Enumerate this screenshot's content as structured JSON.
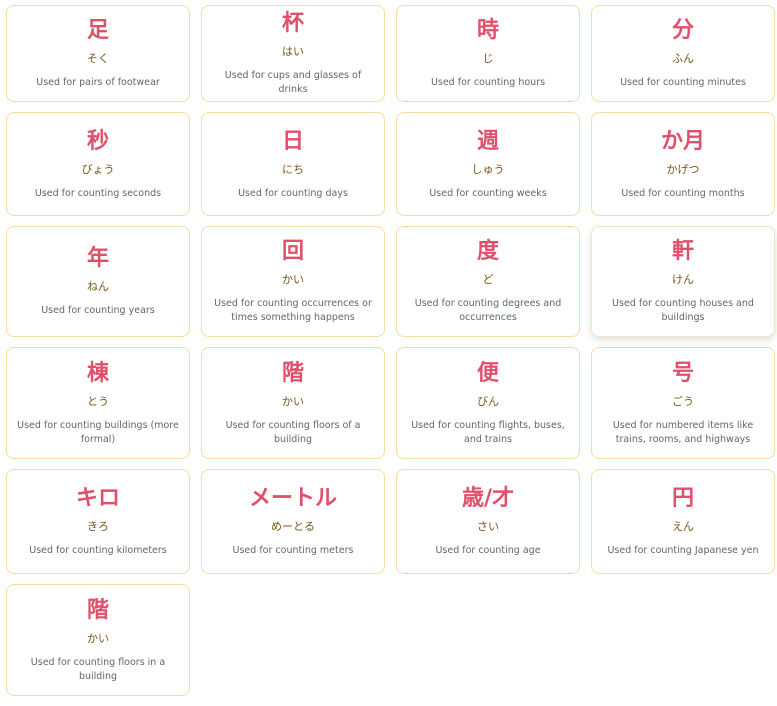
{
  "colors": {
    "kanji": "#e0506a",
    "reading": "#7a5518",
    "description": "#5f6671",
    "card_border": "#f4dca4"
  },
  "counters": [
    {
      "kanji": "足",
      "reading": "そく",
      "description": "Used for pairs of footwear"
    },
    {
      "kanji": "杯",
      "reading": "はい",
      "description": "Used for cups and glasses of drinks"
    },
    {
      "kanji": "時",
      "reading": "じ",
      "description": "Used for counting hours"
    },
    {
      "kanji": "分",
      "reading": "ふん",
      "description": "Used for counting minutes"
    },
    {
      "kanji": "秒",
      "reading": "びょう",
      "description": "Used for counting seconds"
    },
    {
      "kanji": "日",
      "reading": "にち",
      "description": "Used for counting days"
    },
    {
      "kanji": "週",
      "reading": "しゅう",
      "description": "Used for counting weeks"
    },
    {
      "kanji": "か月",
      "reading": "かげつ",
      "description": "Used for counting months"
    },
    {
      "kanji": "年",
      "reading": "ねん",
      "description": "Used for counting years"
    },
    {
      "kanji": "回",
      "reading": "かい",
      "description": "Used for counting occurrences or times something happens"
    },
    {
      "kanji": "度",
      "reading": "ど",
      "description": "Used for counting degrees and occurrences"
    },
    {
      "kanji": "軒",
      "reading": "けん",
      "description": "Used for counting houses and buildings"
    },
    {
      "kanji": "棟",
      "reading": "とう",
      "description": "Used for counting buildings (more formal)"
    },
    {
      "kanji": "階",
      "reading": "かい",
      "description": "Used for counting floors of a building"
    },
    {
      "kanji": "便",
      "reading": "びん",
      "description": "Used for counting flights, buses, and trains"
    },
    {
      "kanji": "号",
      "reading": "ごう",
      "description": "Used for numbered items like trains, rooms, and highways"
    },
    {
      "kanji": "キロ",
      "reading": "きろ",
      "description": "Used for counting kilometers"
    },
    {
      "kanji": "メートル",
      "reading": "めーとる",
      "description": "Used for counting meters"
    },
    {
      "kanji": "歳/才",
      "reading": "さい",
      "description": "Used for counting age"
    },
    {
      "kanji": "円",
      "reading": "えん",
      "description": "Used for counting Japanese yen"
    },
    {
      "kanji": "階",
      "reading": "かい",
      "description": "Used for counting floors in a building"
    }
  ]
}
